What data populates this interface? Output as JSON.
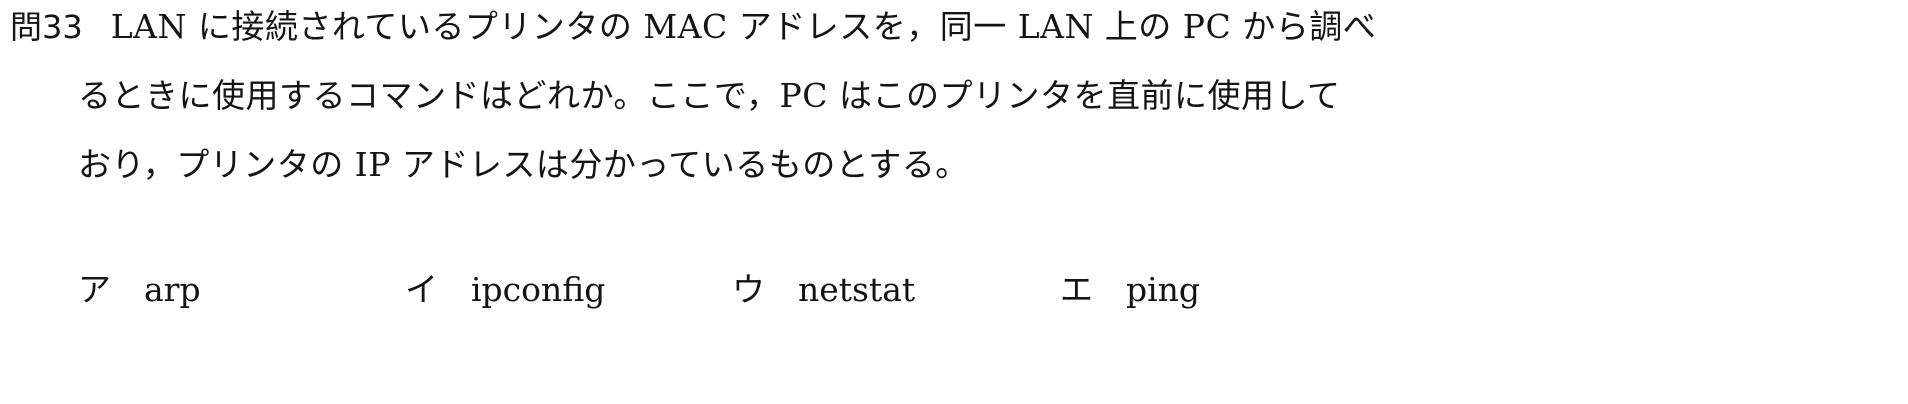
{
  "question": {
    "number": "問33",
    "line1": "LAN に接続されているプリンタの MAC アドレスを，同一 LAN 上の PC から調べ",
    "line2": "るときに使用するコマンドはどれか。ここで，PC はこのプリンタを直前に使用して",
    "line3": "おり，プリンタの IP アドレスは分かっているものとする。"
  },
  "choices": [
    {
      "mark": "ア",
      "text": "arp"
    },
    {
      "mark": "イ",
      "text": "ipconfig"
    },
    {
      "mark": "ウ",
      "text": "netstat"
    },
    {
      "mark": "エ",
      "text": "ping"
    }
  ]
}
